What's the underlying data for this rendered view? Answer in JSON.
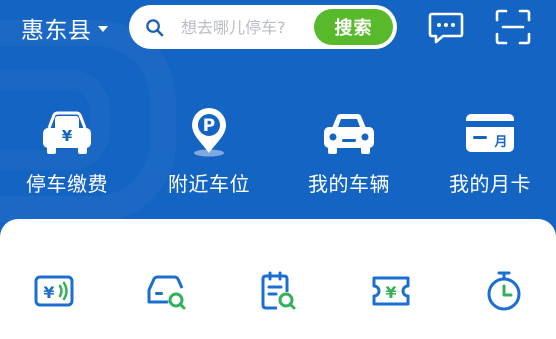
{
  "header": {
    "city": "惠东县",
    "search": {
      "placeholder": "想去哪儿停车?",
      "button": "搜索"
    },
    "icons": [
      "message-icon",
      "scan-icon"
    ]
  },
  "quick_actions": [
    {
      "label": "停车缴费",
      "icon": "car-payment-icon"
    },
    {
      "label": "附近车位",
      "icon": "parking-location-icon"
    },
    {
      "label": "我的车辆",
      "icon": "my-car-icon"
    },
    {
      "label": "我的月卡",
      "icon": "monthly-card-icon"
    }
  ],
  "services": [
    {
      "icon": "payment-code-icon"
    },
    {
      "icon": "car-search-icon"
    },
    {
      "icon": "record-search-icon"
    },
    {
      "icon": "coupon-icon"
    },
    {
      "icon": "timer-icon"
    }
  ],
  "colors": {
    "header_blue": "#1464c3",
    "accent_green": "#58b92a",
    "icon_blue": "#1a6fd0",
    "icon_green": "#33b05a"
  }
}
